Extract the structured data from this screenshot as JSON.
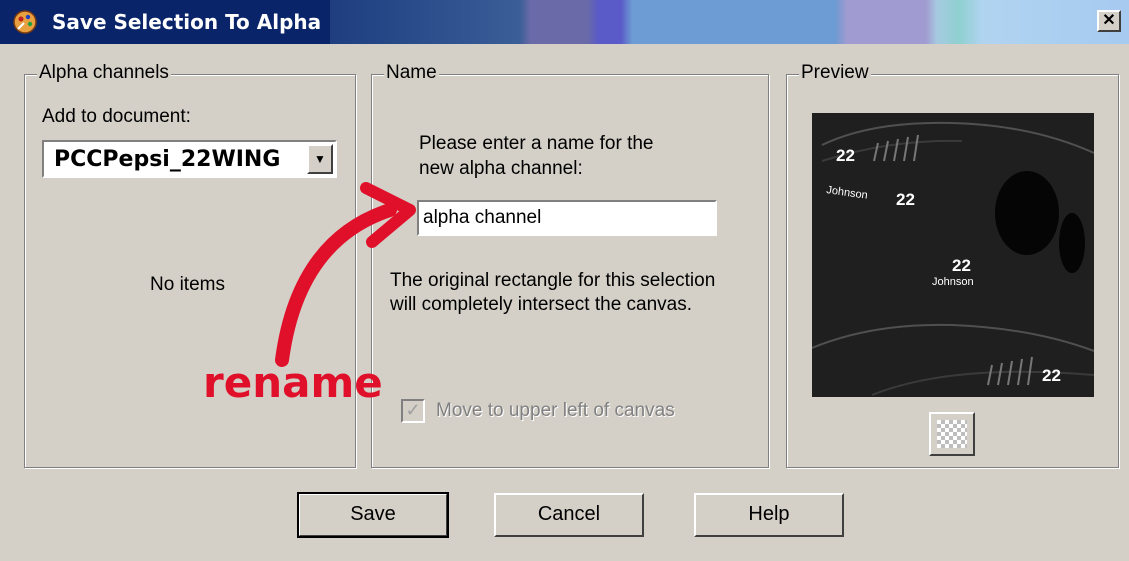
{
  "window": {
    "title": "Save Selection To Alpha",
    "close_glyph": "✕"
  },
  "alpha_channels": {
    "group_label": "Alpha channels",
    "add_to_document_label": "Add to document:",
    "document_value": "PCCPepsi_22WING",
    "dropdown_arrow": "▼",
    "empty_text": "No items"
  },
  "name_group": {
    "group_label": "Name",
    "prompt_line1": "Please enter a name for the",
    "prompt_line2": "new alpha channel:",
    "channel_name_value": "alpha channel",
    "info_line1": "The original rectangle for this selection",
    "info_line2": "will completely intersect the canvas.",
    "move_checkbox_label": "Move to upper left of canvas",
    "move_checkbox_checked": true,
    "move_checkbox_enabled": false
  },
  "preview_group": {
    "group_label": "Preview",
    "texts": {
      "num_top_left": "22",
      "name_left": "Johnson",
      "num_left": "22",
      "num_center": "22",
      "name_center": "Johnson",
      "num_bottom_right": "22"
    }
  },
  "annotation": {
    "text": "rename",
    "color": "#e0102a"
  },
  "buttons": {
    "save": "Save",
    "cancel": "Cancel",
    "help": "Help"
  },
  "colors": {
    "dialog_bg": "#d4d0c8",
    "title_active": "#0a246a",
    "preview_bg": "#1f1f1f"
  },
  "icons": {
    "app": "paint-app-icon",
    "close": "close-icon",
    "dropdown": "chevron-down-icon",
    "transparency": "checkerboard-icon",
    "arrow": "hand-drawn-arrow-icon"
  }
}
